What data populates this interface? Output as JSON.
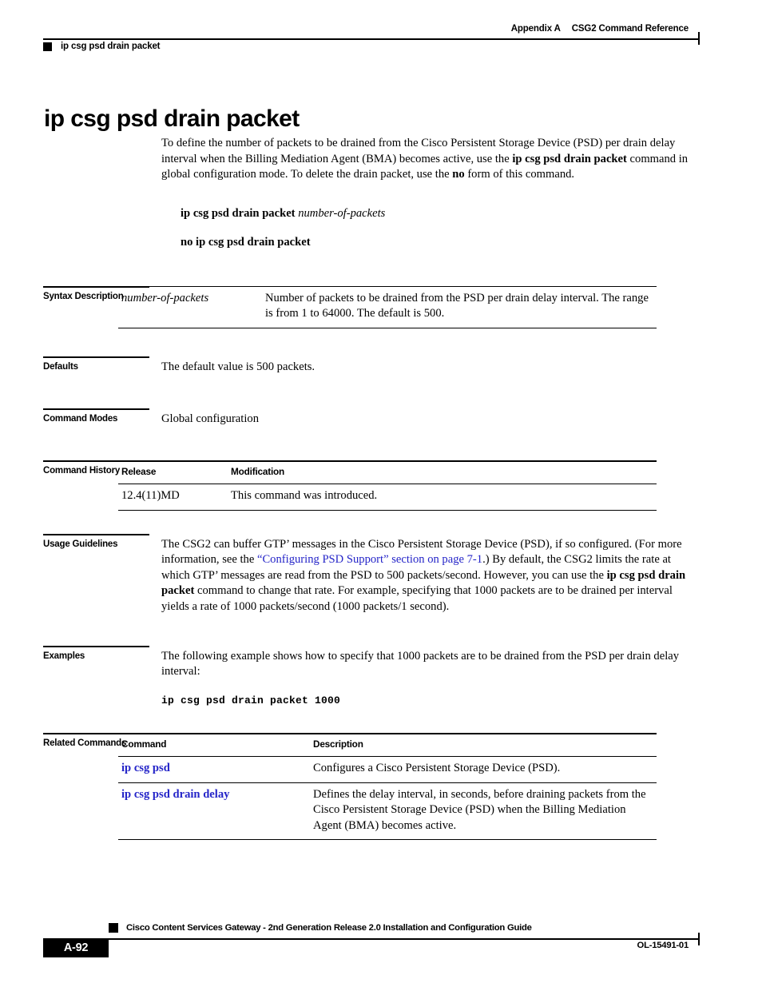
{
  "header": {
    "appendix": "Appendix A",
    "chapter": "CSG2 Command Reference",
    "running_head": "ip csg psd drain packet"
  },
  "title": "ip csg psd drain packet",
  "intro": {
    "part1": "To define the number of packets to be drained from the Cisco Persistent Storage Device (PSD) per drain delay interval when the Billing Mediation Agent (BMA) becomes active, use the ",
    "bold1": "ip csg psd drain packet",
    "part2": " command in global configuration mode. To delete the drain packet, use the ",
    "bold2": "no",
    "part3": " form of this command."
  },
  "syntax_lines": {
    "positive_command": "ip csg psd drain packet",
    "positive_argument": "number-of-packets",
    "negative_command": "no ip csg psd drain packet"
  },
  "sections": {
    "syntax_description": {
      "label": "Syntax Description",
      "rows": [
        {
          "term": "number-of-packets",
          "description": "Number of packets to be drained from the PSD per drain delay interval. The range is from 1 to 64000. The default is 500."
        }
      ]
    },
    "defaults": {
      "label": "Defaults",
      "text": "The default value is 500 packets."
    },
    "command_modes": {
      "label": "Command Modes",
      "text": "Global configuration"
    },
    "command_history": {
      "label": "Command History",
      "headers": [
        "Release",
        "Modification"
      ],
      "rows": [
        {
          "release": "12.4(11)MD",
          "modification": "This command was introduced."
        }
      ]
    },
    "usage_guidelines": {
      "label": "Usage Guidelines",
      "part1": "The CSG2 can buffer GTP’ messages in the Cisco Persistent Storage Device (PSD), if so configured. (For more information, see the ",
      "link": "“Configuring PSD Support” section on page 7-1",
      "part2": ".) By default, the CSG2 limits the rate at which GTP’ messages are read from the PSD to 500 packets/second. However, you can use the ",
      "bold1": "ip csg psd drain packet",
      "part3": " command to change that rate. For example, specifying that 1000 packets are to be drained per interval yields a rate of 1000 packets/second (1000 packets/1 second)."
    },
    "examples": {
      "label": "Examples",
      "text": "The following example shows how to specify that 1000 packets are to be drained from the PSD per drain delay interval:",
      "code": "ip csg psd drain packet 1000"
    },
    "related_commands": {
      "label": "Related Commands",
      "headers": [
        "Command",
        "Description"
      ],
      "rows": [
        {
          "command": "ip csg psd",
          "description": "Configures a Cisco Persistent Storage Device (PSD)."
        },
        {
          "command": "ip csg psd drain delay",
          "description": "Defines the delay interval, in seconds, before draining packets from the Cisco Persistent Storage Device (PSD) when the Billing Mediation Agent (BMA) becomes active."
        }
      ]
    }
  },
  "footer": {
    "doc_title": "Cisco Content Services Gateway - 2nd Generation Release 2.0 Installation and Configuration Guide",
    "page_number": "A-92",
    "doc_id": "OL-15491-01"
  },
  "colors": {
    "link": "#2424C8",
    "text": "#000000",
    "background": "#FFFFFF"
  }
}
